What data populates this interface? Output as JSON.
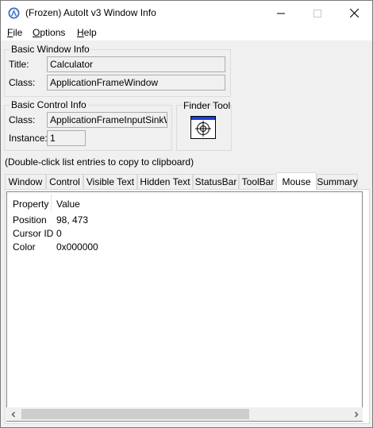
{
  "window": {
    "title": "(Frozen) AutoIt v3 Window Info"
  },
  "menu": {
    "file": "F",
    "file_rest": "ile",
    "options": "O",
    "options_rest": "ptions",
    "help": "H",
    "help_rest": "elp"
  },
  "basic_window": {
    "group_title": "Basic Window Info",
    "title_label": "Title:",
    "title_value": "Calculator",
    "class_label": "Class:",
    "class_value": "ApplicationFrameWindow"
  },
  "basic_control": {
    "group_title": "Basic Control Info",
    "class_label": "Class:",
    "class_value": "ApplicationFrameInputSinkWir",
    "instance_label": "Instance:",
    "instance_value": "1"
  },
  "finder": {
    "group_title": "Finder Tool",
    "icon": "crosshair-target-icon"
  },
  "hint_text": "(Double-click list entries to copy to clipboard)",
  "tabs": [
    {
      "label": "Window"
    },
    {
      "label": "Control"
    },
    {
      "label": "Visible Text"
    },
    {
      "label": "Hidden Text"
    },
    {
      "label": "StatusBar"
    },
    {
      "label": "ToolBar"
    },
    {
      "label": "Mouse"
    },
    {
      "label": "Summary"
    }
  ],
  "active_tab": "Mouse",
  "list": {
    "columns": [
      "Property",
      "Value"
    ],
    "rows": [
      {
        "property": "Position",
        "value": "98, 473"
      },
      {
        "property": "Cursor ID",
        "value": "0"
      },
      {
        "property": "Color",
        "value": "0x000000"
      }
    ]
  },
  "colors": {
    "window_bg": "#f0f0f0",
    "title_icon_blue": "#3f6ec6",
    "finder_bar_blue": "#1a3fd6"
  }
}
